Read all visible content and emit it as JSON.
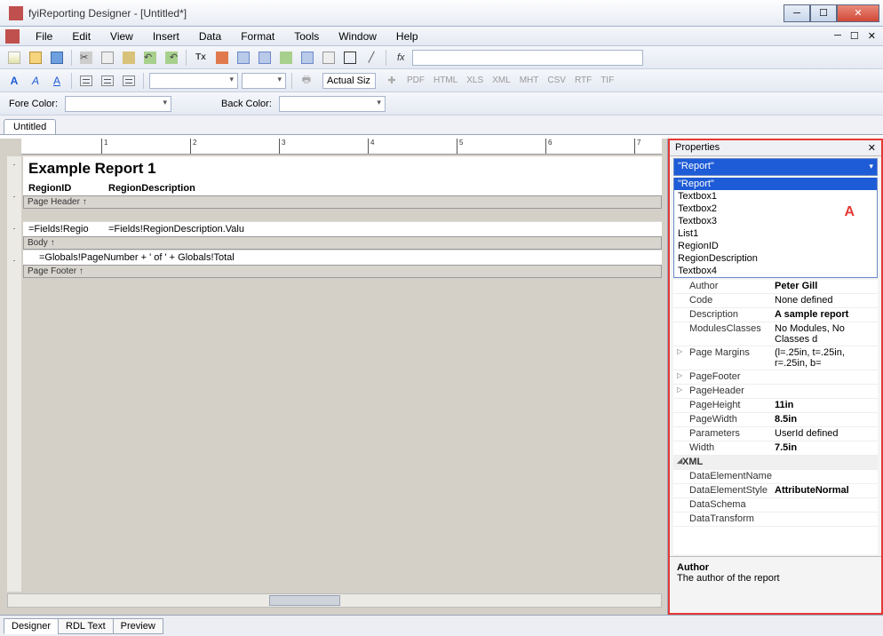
{
  "window": {
    "title": "fyiReporting Designer - [Untitled*]"
  },
  "menus": [
    "File",
    "Edit",
    "View",
    "Insert",
    "Data",
    "Format",
    "Tools",
    "Window",
    "Help"
  ],
  "toolbar2": {
    "zoom": "Actual Siz",
    "formats": [
      "PDF",
      "HTML",
      "XLS",
      "XML",
      "MHT",
      "CSV",
      "RTF",
      "TIF"
    ]
  },
  "colorbar": {
    "fore_label": "Fore Color:",
    "back_label": "Back Color:"
  },
  "doctab": "Untitled",
  "ruler_ticks": [
    "1",
    "2",
    "3",
    "4",
    "5",
    "6",
    "7"
  ],
  "report": {
    "title": "Example Report 1",
    "columns": [
      "RegionID",
      "RegionDescription"
    ],
    "header_label": "Page Header ↑",
    "body_label": "Body ↑",
    "footer_label": "Page Footer ↑",
    "field_row": [
      "=Fields!Regio",
      "=Fields!RegionDescription.Valu"
    ],
    "footer_expr": "=Globals!PageNumber + ' of ' + Globals!Total"
  },
  "properties": {
    "panel_title": "Properties",
    "combo_value": "\"Report\"",
    "annotation": "A",
    "dropdown": [
      "\"Report\"",
      "Textbox1",
      "Textbox2",
      "Textbox3",
      "List1",
      "RegionID",
      "RegionDescription",
      "Textbox4"
    ],
    "rows": [
      {
        "k": "Author",
        "v": "Peter Gill",
        "bold": true
      },
      {
        "k": "Code",
        "v": "None defined"
      },
      {
        "k": "Description",
        "v": "A sample report",
        "bold": true
      },
      {
        "k": "ModulesClasses",
        "v": "No Modules, No Classes d"
      },
      {
        "k": "Page Margins",
        "v": "(l=.25in, t=.25in, r=.25in, b=",
        "tw": true
      },
      {
        "k": "PageFooter",
        "v": "",
        "tw": true
      },
      {
        "k": "PageHeader",
        "v": "",
        "tw": true
      },
      {
        "k": "PageHeight",
        "v": "11in",
        "bold": true
      },
      {
        "k": "PageWidth",
        "v": "8.5in",
        "bold": true
      },
      {
        "k": "Parameters",
        "v": "UserId defined"
      },
      {
        "k": "Width",
        "v": "7.5in",
        "bold": true
      },
      {
        "cat": true,
        "k": "XML",
        "v": "",
        "twd": true
      },
      {
        "k": "DataElementName",
        "v": ""
      },
      {
        "k": "DataElementStyle",
        "v": "AttributeNormal",
        "bold": true
      },
      {
        "k": "DataSchema",
        "v": ""
      },
      {
        "k": "DataTransform",
        "v": ""
      }
    ],
    "desc": {
      "title": "Author",
      "text": "The author of the report"
    }
  },
  "bottom_tabs": [
    "Designer",
    "RDL Text",
    "Preview"
  ]
}
